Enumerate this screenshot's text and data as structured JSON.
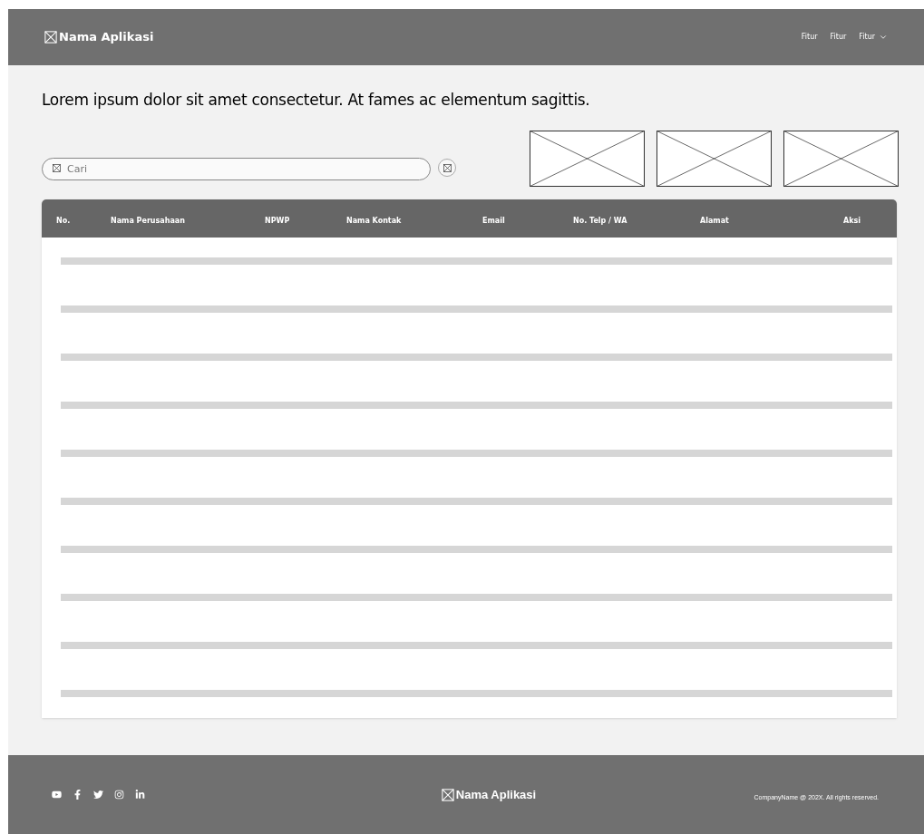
{
  "header": {
    "app_name": "Nama Aplikasi",
    "nav": [
      {
        "label": "Fitur",
        "kind": "link"
      },
      {
        "label": "Fitur",
        "kind": "link"
      },
      {
        "label": "Fitur",
        "kind": "dropdown"
      }
    ]
  },
  "headline": "Lorem ipsum dolor sit amet consectetur. At fames ac elementum sagittis.",
  "search": {
    "placeholder": "Cari"
  },
  "table": {
    "columns": [
      "No.",
      "Nama Perusahaan",
      "NPWP",
      "Nama Kontak",
      "Email",
      "No. Telp / WA",
      "Alamat",
      "Aksi"
    ],
    "rows": [
      {
        "kind": "placeholder"
      },
      {
        "kind": "placeholder"
      },
      {
        "kind": "placeholder"
      },
      {
        "kind": "placeholder"
      },
      {
        "kind": "placeholder"
      },
      {
        "kind": "placeholder"
      },
      {
        "kind": "placeholder"
      },
      {
        "kind": "placeholder"
      },
      {
        "kind": "placeholder"
      },
      {
        "kind": "placeholder"
      }
    ]
  },
  "footer": {
    "social_links": [
      {
        "kind": "youtube"
      },
      {
        "kind": "facebook"
      },
      {
        "kind": "twitter"
      },
      {
        "kind": "instagram"
      },
      {
        "kind": "linkedin"
      }
    ],
    "app_name": "Nama Aplikasi",
    "copyright": "CompanyName @ 202X. All rights reserved."
  }
}
